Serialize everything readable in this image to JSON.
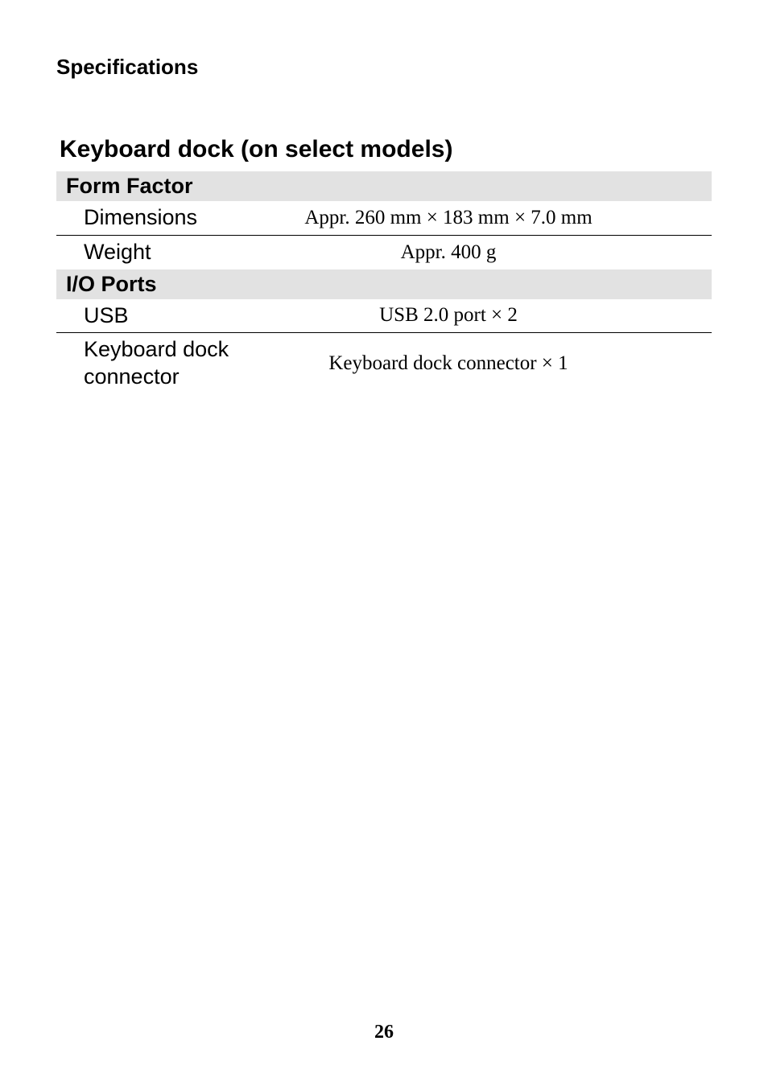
{
  "header": "Specifications",
  "section_title": "Keyboard dock (on select models)",
  "groups": [
    {
      "name": "Form Factor",
      "rows": [
        {
          "label": "Dimensions",
          "value": "Appr. 260 mm × 183 mm × 7.0 mm"
        },
        {
          "label": "Weight",
          "value": "Appr. 400 g"
        }
      ]
    },
    {
      "name": "I/O Ports",
      "rows": [
        {
          "label": "USB",
          "value": "USB 2.0 port × 2"
        },
        {
          "label": "Keyboard dock connector",
          "value": "Keyboard dock connector × 1"
        }
      ]
    }
  ],
  "page_number": "26"
}
